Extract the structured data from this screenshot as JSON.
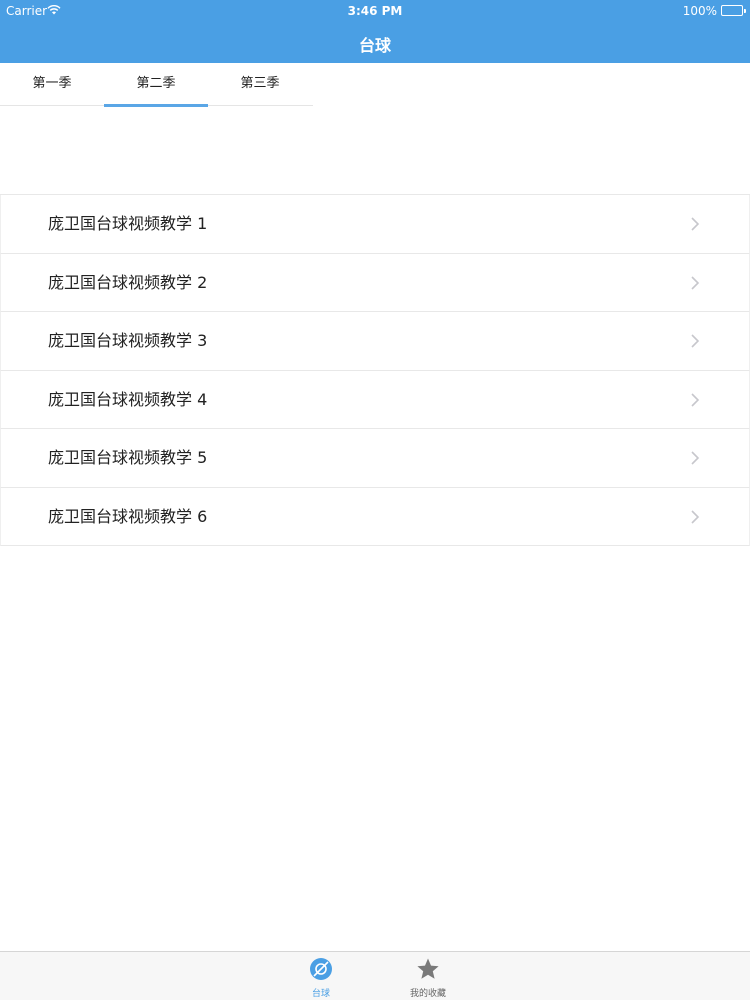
{
  "status_bar": {
    "carrier": "Carrier",
    "time": "3:46 PM",
    "battery": "100%"
  },
  "nav": {
    "title": "台球"
  },
  "tabs": [
    {
      "label": "第一季",
      "active": false
    },
    {
      "label": "第二季",
      "active": true
    },
    {
      "label": "第三季",
      "active": false
    }
  ],
  "list": {
    "items": [
      {
        "title": "庞卫国台球视频教学 1"
      },
      {
        "title": "庞卫国台球视频教学 2"
      },
      {
        "title": "庞卫国台球视频教学 3"
      },
      {
        "title": "庞卫国台球视频教学 4"
      },
      {
        "title": "庞卫国台球视频教学 5"
      },
      {
        "title": "庞卫国台球视频教学 6"
      }
    ]
  },
  "tab_bar": {
    "items": [
      {
        "label": "台球",
        "icon": "billiards-icon",
        "active": true
      },
      {
        "label": "我的收藏",
        "icon": "star-icon",
        "active": false
      }
    ]
  },
  "colors": {
    "accent": "#4a9fe4",
    "tab_indicator": "#5aa6e6",
    "chevron": "#c7c7cc"
  }
}
